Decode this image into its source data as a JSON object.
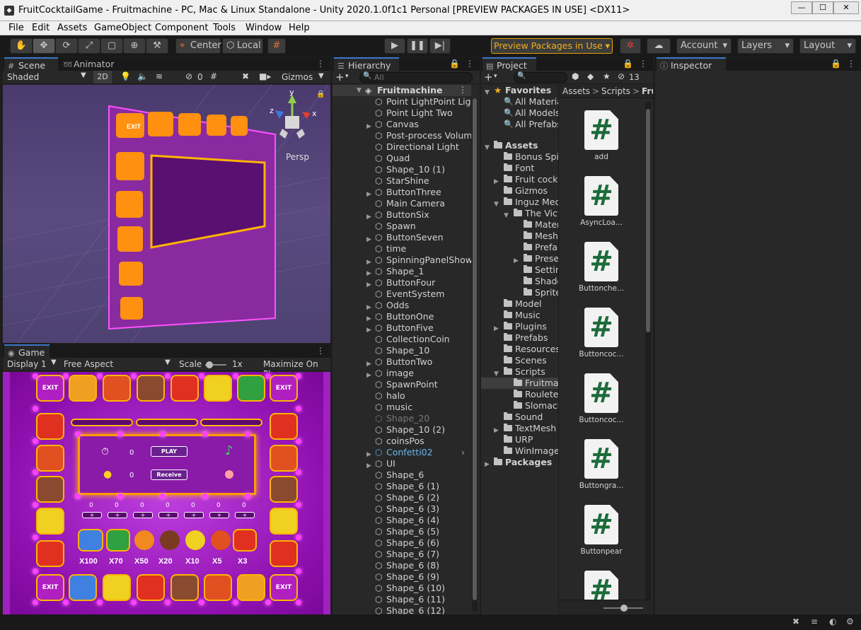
{
  "window": {
    "title": "FruitCocktailGame - Fruitmachine - PC, Mac & Linux Standalone - Unity 2020.1.0f1c1 Personal [PREVIEW PACKAGES IN USE] <DX11>",
    "minimize": "—",
    "maximize": "☐",
    "close": "✕"
  },
  "menu": [
    "File",
    "Edit",
    "Assets",
    "GameObject",
    "Component",
    "Tools",
    "Window",
    "Help"
  ],
  "toolbar": {
    "pivot": "Center",
    "space": "Local",
    "preview_packages": "Preview Packages in Use",
    "account": "Account",
    "layers": "Layers",
    "layout": "Layout"
  },
  "scene": {
    "tab_scene": "Scene",
    "tab_animator": "Animator",
    "shading": "Shaded",
    "mode_2d": "2D",
    "fx_count": "0",
    "gizmos": "Gizmos",
    "persp": "Persp",
    "axis_x": "x",
    "axis_y": "y",
    "axis_z": "z"
  },
  "game": {
    "tab": "Game",
    "display": "Display 1",
    "aspect": "Free Aspect",
    "scale_label": "Scale",
    "scale_value": "1x",
    "maximize": "Maximize On Pla",
    "exit": "EXIT",
    "play": "PLAY",
    "receive": "Receive",
    "counter1": "0",
    "counter2": "0",
    "bet_values": [
      "0",
      "0",
      "0",
      "0",
      "0",
      "0",
      "0"
    ],
    "multipliers": [
      "X100",
      "X70",
      "X50",
      "X20",
      "X10",
      "X5",
      "X3"
    ]
  },
  "hierarchy": {
    "tab": "Hierarchy",
    "search_placeholder": "All",
    "root": "Fruitmachine",
    "items": [
      {
        "label": "Point LightPoint Light",
        "arrow": false,
        "dim": false
      },
      {
        "label": "Point Light Two",
        "arrow": false,
        "dim": false
      },
      {
        "label": "Canvas",
        "arrow": true,
        "dim": false
      },
      {
        "label": "Post-process Volume",
        "arrow": false,
        "dim": false
      },
      {
        "label": "Directional Light",
        "arrow": false,
        "dim": false
      },
      {
        "label": "Quad",
        "arrow": false,
        "dim": false
      },
      {
        "label": "Shape_10 (1)",
        "arrow": false,
        "dim": false
      },
      {
        "label": "StarShine",
        "arrow": false,
        "dim": false
      },
      {
        "label": "ButtonThree",
        "arrow": true,
        "dim": false
      },
      {
        "label": "Main Camera",
        "arrow": false,
        "dim": false
      },
      {
        "label": "ButtonSix",
        "arrow": true,
        "dim": false
      },
      {
        "label": "Spawn",
        "arrow": false,
        "dim": false
      },
      {
        "label": "ButtonSeven",
        "arrow": true,
        "dim": false
      },
      {
        "label": "time",
        "arrow": false,
        "dim": false
      },
      {
        "label": "SpinningPanelShow",
        "arrow": true,
        "dim": false
      },
      {
        "label": "Shape_1",
        "arrow": true,
        "dim": false
      },
      {
        "label": "ButtonFour",
        "arrow": true,
        "dim": false
      },
      {
        "label": "EventSystem",
        "arrow": false,
        "dim": false
      },
      {
        "label": "Odds",
        "arrow": true,
        "dim": false
      },
      {
        "label": "ButtonOne",
        "arrow": true,
        "dim": false
      },
      {
        "label": "ButtonFive",
        "arrow": true,
        "dim": false
      },
      {
        "label": "CollectionCoin",
        "arrow": false,
        "dim": false
      },
      {
        "label": "Shape_10",
        "arrow": false,
        "dim": false
      },
      {
        "label": "ButtonTwo",
        "arrow": true,
        "dim": false
      },
      {
        "label": "image",
        "arrow": true,
        "dim": false
      },
      {
        "label": "SpawnPoint",
        "arrow": false,
        "dim": false
      },
      {
        "label": "halo",
        "arrow": false,
        "dim": false
      },
      {
        "label": "music",
        "arrow": false,
        "dim": false
      },
      {
        "label": "Shape_20",
        "arrow": false,
        "dim": true
      },
      {
        "label": "Shape_10 (2)",
        "arrow": false,
        "dim": false
      },
      {
        "label": "coinsPos",
        "arrow": false,
        "dim": false
      },
      {
        "label": "Confetti02",
        "arrow": true,
        "dim": false,
        "prefab": true
      },
      {
        "label": "UI",
        "arrow": true,
        "dim": false
      },
      {
        "label": "Shape_6",
        "arrow": false,
        "dim": false
      },
      {
        "label": "Shape_6 (1)",
        "arrow": false,
        "dim": false
      },
      {
        "label": "Shape_6 (2)",
        "arrow": false,
        "dim": false
      },
      {
        "label": "Shape_6 (3)",
        "arrow": false,
        "dim": false
      },
      {
        "label": "Shape_6 (4)",
        "arrow": false,
        "dim": false
      },
      {
        "label": "Shape_6 (5)",
        "arrow": false,
        "dim": false
      },
      {
        "label": "Shape_6 (6)",
        "arrow": false,
        "dim": false
      },
      {
        "label": "Shape_6 (7)",
        "arrow": false,
        "dim": false
      },
      {
        "label": "Shape_6 (8)",
        "arrow": false,
        "dim": false
      },
      {
        "label": "Shape_6 (9)",
        "arrow": false,
        "dim": false
      },
      {
        "label": "Shape_6 (10)",
        "arrow": false,
        "dim": false
      },
      {
        "label": "Shape_6 (11)",
        "arrow": false,
        "dim": false
      },
      {
        "label": "Shape_6 (12)",
        "arrow": false,
        "dim": false
      }
    ]
  },
  "project": {
    "tab": "Project",
    "hidden_count": "13",
    "favorites": "Favorites",
    "fav_items": [
      "All Materia",
      "All Models",
      "All Prefabs"
    ],
    "assets": "Assets",
    "tree": [
      {
        "label": "Bonus Spin",
        "indent": 0,
        "arrow": false
      },
      {
        "label": "Font",
        "indent": 0,
        "arrow": false
      },
      {
        "label": "Fruit cockt",
        "indent": 0,
        "arrow": true
      },
      {
        "label": "Gizmos",
        "indent": 0,
        "arrow": false
      },
      {
        "label": "Inguz Medi",
        "indent": 0,
        "arrow": true,
        "open": true
      },
      {
        "label": "The Vict",
        "indent": 1,
        "arrow": true,
        "open": true
      },
      {
        "label": "Mater",
        "indent": 2,
        "arrow": false
      },
      {
        "label": "Mesh",
        "indent": 2,
        "arrow": false
      },
      {
        "label": "Prefal",
        "indent": 2,
        "arrow": false
      },
      {
        "label": "Prese",
        "indent": 2,
        "arrow": true
      },
      {
        "label": "Settin",
        "indent": 2,
        "arrow": false
      },
      {
        "label": "Shade",
        "indent": 2,
        "arrow": false
      },
      {
        "label": "Sprite",
        "indent": 2,
        "arrow": false
      },
      {
        "label": "Model",
        "indent": 0,
        "arrow": false
      },
      {
        "label": "Music",
        "indent": 0,
        "arrow": false
      },
      {
        "label": "Plugins",
        "indent": 0,
        "arrow": true
      },
      {
        "label": "Prefabs",
        "indent": 0,
        "arrow": false
      },
      {
        "label": "Resources",
        "indent": 0,
        "arrow": false
      },
      {
        "label": "Scenes",
        "indent": 0,
        "arrow": false
      },
      {
        "label": "Scripts",
        "indent": 0,
        "arrow": true,
        "open": true
      },
      {
        "label": "Fruitmac",
        "indent": 1,
        "arrow": false,
        "selected": true
      },
      {
        "label": "Roulete",
        "indent": 1,
        "arrow": false
      },
      {
        "label": "Slomach",
        "indent": 1,
        "arrow": false
      },
      {
        "label": "Sound",
        "indent": 0,
        "arrow": false
      },
      {
        "label": "TextMesh I",
        "indent": 0,
        "arrow": true
      },
      {
        "label": "URP",
        "indent": 0,
        "arrow": false
      },
      {
        "label": "WinImage",
        "indent": 0,
        "arrow": false
      }
    ],
    "packages": "Packages",
    "breadcrumb": [
      "Assets",
      "Scripts",
      "Fru"
    ],
    "files": [
      "add",
      "AsyncLoa...",
      "Buttonche...",
      "Buttoncoc...",
      "Buttoncoc...",
      "Buttongra...",
      "Buttonpear",
      ""
    ]
  },
  "inspector": {
    "tab": "Inspector"
  },
  "colors": {
    "accent": "#3a78c8",
    "preview_border": "#e6a000",
    "script_green": "#1c6b3a",
    "game_bg": "#a020c0"
  }
}
